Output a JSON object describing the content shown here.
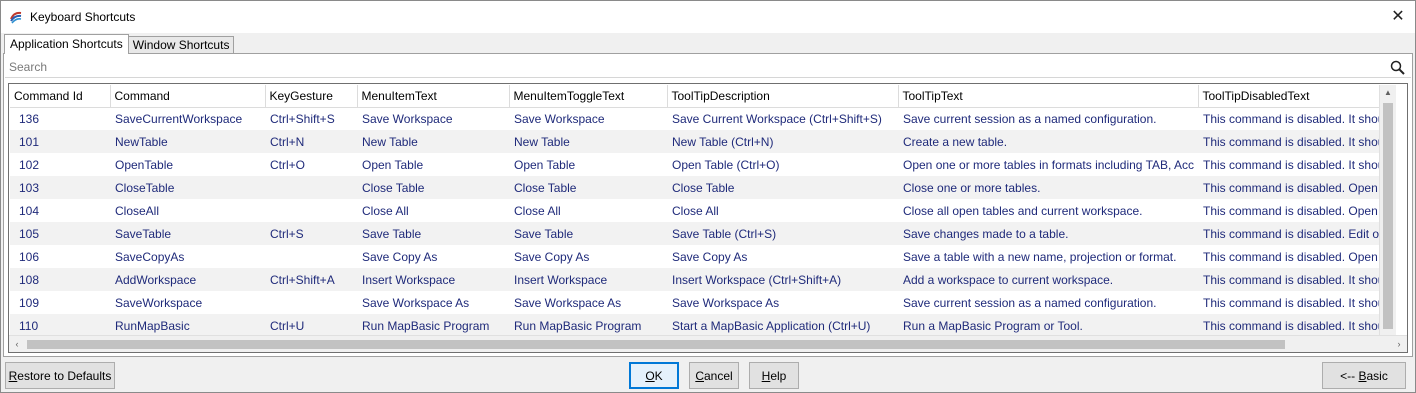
{
  "window": {
    "title": "Keyboard Shortcuts",
    "close_glyph": "✕"
  },
  "tabs": [
    {
      "label": "Application Shortcuts",
      "active": true
    },
    {
      "label": "Window Shortcuts",
      "active": false
    }
  ],
  "search": {
    "placeholder": "Search",
    "value": ""
  },
  "grid": {
    "columns": [
      "Command Id",
      "Command",
      "KeyGesture",
      "MenuItemText",
      "MenuItemToggleText",
      "ToolTipDescription",
      "ToolTipText",
      "ToolTipDisabledText"
    ],
    "rows": [
      [
        "136",
        "SaveCurrentWorkspace",
        "Ctrl+Shift+S",
        "Save Workspace",
        "Save Workspace",
        "Save Current Workspace (Ctrl+Shift+S)",
        "Save current session as a named configuration.",
        "This command is disabled. It should"
      ],
      [
        "101",
        "NewTable",
        "Ctrl+N",
        "New Table",
        "New Table",
        "New Table (Ctrl+N)",
        "Create a new table.",
        "This command is disabled. It should"
      ],
      [
        "102",
        "OpenTable",
        "Ctrl+O",
        "Open Table",
        "Open Table",
        "Open Table (Ctrl+O)",
        "Open one or more tables in formats including TAB, Acc",
        "This command is disabled. It should"
      ],
      [
        "103",
        "CloseTable",
        "",
        "Close Table",
        "Close Table",
        "Close Table",
        "Close one or more tables.",
        "This command is disabled. Open on"
      ],
      [
        "104",
        "CloseAll",
        "",
        "Close All",
        "Close All",
        "Close All",
        "Close all open tables and current workspace.",
        "This command is disabled. Open on"
      ],
      [
        "105",
        "SaveTable",
        "Ctrl+S",
        "Save Table",
        "Save Table",
        "Save Table (Ctrl+S)",
        "Save changes made to a table.",
        "This command is disabled. Edit one"
      ],
      [
        "106",
        "SaveCopyAs",
        "",
        "Save Copy As",
        "Save Copy As",
        "Save Copy As",
        "Save a table with a new name, projection or format.",
        "This command is disabled. Open on"
      ],
      [
        "108",
        "AddWorkspace",
        "Ctrl+Shift+A",
        "Insert Workspace",
        "Insert Workspace",
        "Insert Workspace (Ctrl+Shift+A)",
        "Add a workspace to current workspace.",
        "This command is disabled. It should"
      ],
      [
        "109",
        "SaveWorkspace",
        "",
        "Save Workspace As",
        "Save Workspace As",
        "Save Workspace As",
        "Save current session as a named configuration.",
        "This command is disabled. It should"
      ],
      [
        "110",
        "RunMapBasic",
        "Ctrl+U",
        "Run MapBasic Program",
        "Run MapBasic Program",
        "Start a MapBasic Application (Ctrl+U)",
        "Run a MapBasic Program or Tool.",
        "This command is disabled. It should"
      ]
    ]
  },
  "buttons": {
    "restore": {
      "u": "R",
      "rest": "estore to Defaults"
    },
    "ok": {
      "u": "O",
      "rest": "K"
    },
    "cancel": {
      "u": "C",
      "rest": "ancel"
    },
    "help": {
      "u": "H",
      "rest": "elp"
    },
    "basic": {
      "pre": "<-- ",
      "u": "B",
      "rest": "asic"
    }
  },
  "colors": {
    "cell_text": "#1f2a7a",
    "alt_row": "#f2f2f2",
    "default_button_border": "#0078d7"
  },
  "icons": {
    "app": "mapinfo-logo-icon",
    "search": "magnifier-icon",
    "close": "close-icon"
  }
}
